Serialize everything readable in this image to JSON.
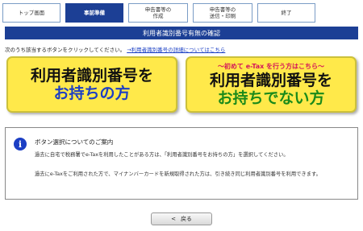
{
  "steps": [
    {
      "label": "トップ画面",
      "active": false
    },
    {
      "label": "事前準備",
      "active": true
    },
    {
      "label": "申告書等の\n作成",
      "active": false
    },
    {
      "label": "申告書等の\n送信・印刷",
      "active": false
    },
    {
      "label": "終了",
      "active": false
    }
  ],
  "page_title": "利用者識別番号有無の確認",
  "instruction": {
    "text": "次のうち該当するボタンをクリックしてください。",
    "link": "→利用者識別番号の詳細についてはこちら"
  },
  "buttons": {
    "has_id": {
      "line1": "利用者識別番号を",
      "line2": "お持ちの方"
    },
    "no_id": {
      "banner": "〜初めて e-Tax を行う方はこちら〜",
      "line1": "利用者識別番号を",
      "line2": "お持ちでない方"
    }
  },
  "info": {
    "icon": "info-icon",
    "title": "ボタン選択についてのご案内",
    "para1": "過去に自宅で税務署でe-Taxを利用したことがある方は、「利用者識別番号をお持ちの方」を選択してください。",
    "para2": "過去にe-Taxをご利用された方で、マイナンバーカードを新規取得された方は、引き続き同じ利用者識別番号を利用できます。"
  },
  "back_button": {
    "label": "戻る",
    "icon": "chevron-left-icon"
  },
  "colors": {
    "primary": "#1c3f95",
    "button_yellow": "#ffe94a",
    "link": "#1a3fc4"
  }
}
